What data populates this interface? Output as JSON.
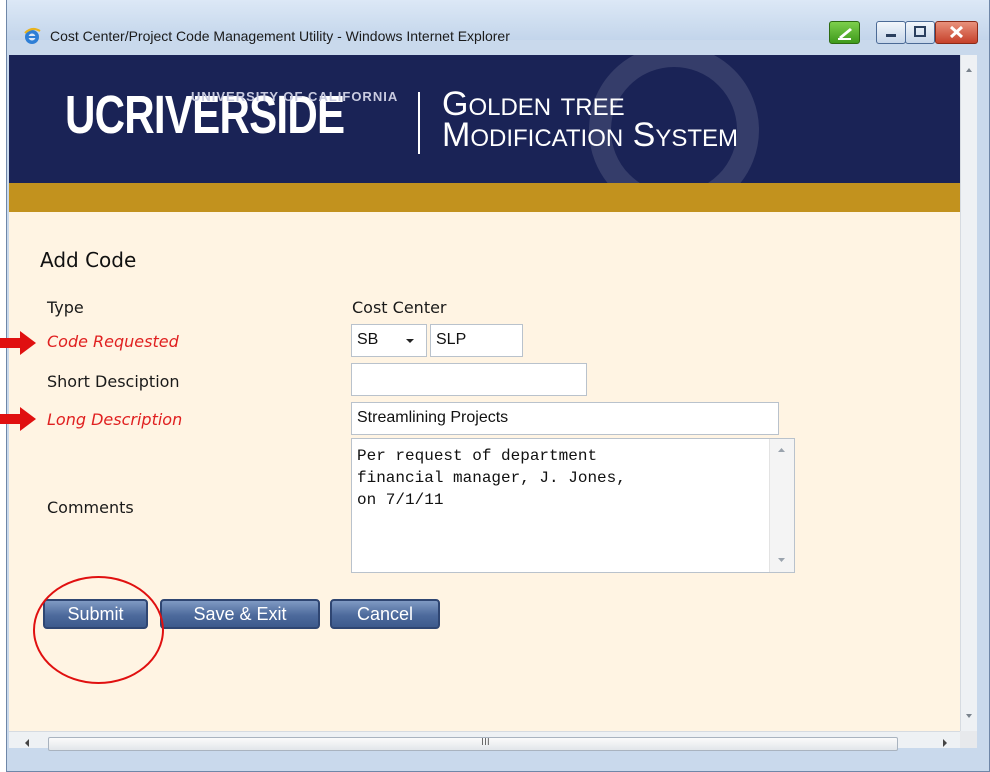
{
  "window": {
    "title": "Cost Center/Project Code Management Utility - Windows Internet Explorer",
    "icons": [
      "ie-icon",
      "compatibility-icon",
      "minimize-icon",
      "maximize-icon",
      "close-icon"
    ]
  },
  "banner": {
    "logo_main": "UCRIVERSIDE",
    "logo_small": "UNIVERSITY OF CALIFORNIA",
    "system_line1": "Golden tree",
    "system_line2": "Modification System",
    "colors": {
      "banner": "#1a2356",
      "gold_bar": "#c2921e"
    }
  },
  "form": {
    "heading": "Add Code",
    "type": {
      "label": "Type",
      "value": "Cost Center"
    },
    "code_requested": {
      "label": "Code Requested",
      "select_value": "SB",
      "input_value": "SLP"
    },
    "short_description": {
      "label": "Short Desciption",
      "value": ""
    },
    "long_description": {
      "label": "Long Description",
      "value": "Streamlining Projects"
    },
    "comments": {
      "label": "Comments",
      "lines": [
        "Per request of department",
        "financial manager, J. Jones,",
        "on 7/1/11"
      ]
    },
    "required_color": "#e02020"
  },
  "buttons": {
    "submit": "Submit",
    "save_exit": "Save & Exit",
    "cancel": "Cancel"
  },
  "scrollbar": {
    "grip": "III"
  }
}
